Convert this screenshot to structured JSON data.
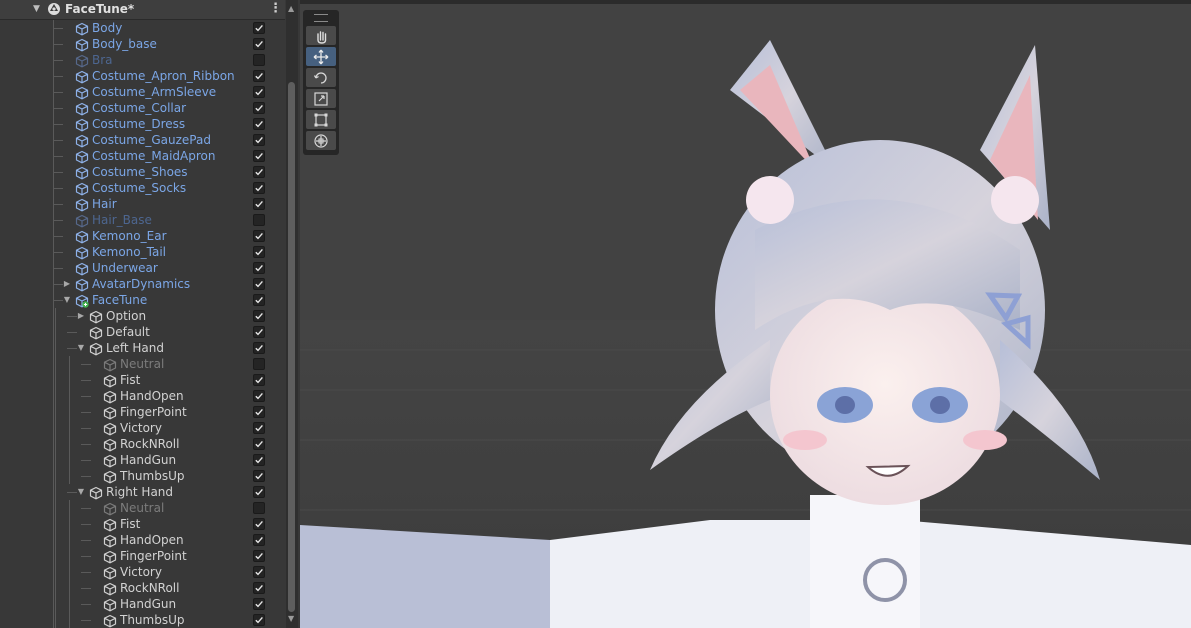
{
  "hierarchy": {
    "title": "FaceTune*",
    "items": [
      {
        "label": "Body",
        "depth": 1,
        "type": "prefab",
        "active": true,
        "checked": true,
        "fold": "none",
        "selected": false
      },
      {
        "label": "Body_base",
        "depth": 1,
        "type": "prefab",
        "active": true,
        "checked": true,
        "fold": "none",
        "selected": false
      },
      {
        "label": "Bra",
        "depth": 1,
        "type": "prefab",
        "active": false,
        "checked": false,
        "fold": "none",
        "selected": false
      },
      {
        "label": "Costume_Apron_Ribbon",
        "depth": 1,
        "type": "prefab",
        "active": true,
        "checked": true,
        "fold": "none",
        "selected": false
      },
      {
        "label": "Costume_ArmSleeve",
        "depth": 1,
        "type": "prefab",
        "active": true,
        "checked": true,
        "fold": "none",
        "selected": false
      },
      {
        "label": "Costume_Collar",
        "depth": 1,
        "type": "prefab",
        "active": true,
        "checked": true,
        "fold": "none",
        "selected": false
      },
      {
        "label": "Costume_Dress",
        "depth": 1,
        "type": "prefab",
        "active": true,
        "checked": true,
        "fold": "none",
        "selected": false
      },
      {
        "label": "Costume_GauzePad",
        "depth": 1,
        "type": "prefab",
        "active": true,
        "checked": true,
        "fold": "none",
        "selected": false
      },
      {
        "label": "Costume_MaidApron",
        "depth": 1,
        "type": "prefab",
        "active": true,
        "checked": true,
        "fold": "none",
        "selected": false
      },
      {
        "label": "Costume_Shoes",
        "depth": 1,
        "type": "prefab",
        "active": true,
        "checked": true,
        "fold": "none",
        "selected": false
      },
      {
        "label": "Costume_Socks",
        "depth": 1,
        "type": "prefab",
        "active": true,
        "checked": true,
        "fold": "none",
        "selected": false
      },
      {
        "label": "Hair",
        "depth": 1,
        "type": "prefab",
        "active": true,
        "checked": true,
        "fold": "none",
        "selected": false
      },
      {
        "label": "Hair_Base",
        "depth": 1,
        "type": "prefab",
        "active": false,
        "checked": false,
        "fold": "none",
        "selected": false
      },
      {
        "label": "Kemono_Ear",
        "depth": 1,
        "type": "prefab",
        "active": true,
        "checked": true,
        "fold": "none",
        "selected": false
      },
      {
        "label": "Kemono_Tail",
        "depth": 1,
        "type": "prefab",
        "active": true,
        "checked": true,
        "fold": "none",
        "selected": false
      },
      {
        "label": "Underwear",
        "depth": 1,
        "type": "prefab",
        "active": true,
        "checked": true,
        "fold": "none",
        "selected": false
      },
      {
        "label": "AvatarDynamics",
        "depth": 1,
        "type": "prefab-variant",
        "active": true,
        "checked": true,
        "fold": "collapsed",
        "selected": false
      },
      {
        "label": "FaceTune",
        "depth": 1,
        "type": "prefab-added",
        "active": true,
        "checked": true,
        "fold": "expanded",
        "selected": false
      },
      {
        "label": "Option",
        "depth": 2,
        "type": "normal",
        "active": true,
        "checked": true,
        "fold": "collapsed",
        "selected": false
      },
      {
        "label": "Default",
        "depth": 2,
        "type": "normal",
        "active": true,
        "checked": true,
        "fold": "none",
        "selected": false
      },
      {
        "label": "Left Hand",
        "depth": 2,
        "type": "normal",
        "active": true,
        "checked": true,
        "fold": "expanded",
        "selected": false
      },
      {
        "label": "Neutral",
        "depth": 3,
        "type": "normal",
        "active": false,
        "checked": false,
        "fold": "none",
        "selected": false
      },
      {
        "label": "Fist",
        "depth": 3,
        "type": "normal",
        "active": true,
        "checked": true,
        "fold": "none",
        "selected": false
      },
      {
        "label": "HandOpen",
        "depth": 3,
        "type": "normal",
        "active": true,
        "checked": true,
        "fold": "none",
        "selected": false
      },
      {
        "label": "FingerPoint",
        "depth": 3,
        "type": "normal",
        "active": true,
        "checked": true,
        "fold": "none",
        "selected": false
      },
      {
        "label": "Victory",
        "depth": 3,
        "type": "normal",
        "active": true,
        "checked": true,
        "fold": "none",
        "selected": false
      },
      {
        "label": "RockNRoll",
        "depth": 3,
        "type": "normal",
        "active": true,
        "checked": true,
        "fold": "none",
        "selected": false
      },
      {
        "label": "HandGun",
        "depth": 3,
        "type": "normal",
        "active": true,
        "checked": true,
        "fold": "none",
        "selected": false
      },
      {
        "label": "ThumbsUp",
        "depth": 3,
        "type": "normal",
        "active": true,
        "checked": true,
        "fold": "none",
        "selected": false
      },
      {
        "label": "Right Hand",
        "depth": 2,
        "type": "normal",
        "active": true,
        "checked": true,
        "fold": "expanded",
        "selected": false
      },
      {
        "label": "Neutral",
        "depth": 3,
        "type": "normal",
        "active": false,
        "checked": false,
        "fold": "none",
        "selected": false
      },
      {
        "label": "Fist",
        "depth": 3,
        "type": "normal",
        "active": true,
        "checked": true,
        "fold": "none",
        "selected": false
      },
      {
        "label": "HandOpen",
        "depth": 3,
        "type": "normal",
        "active": true,
        "checked": true,
        "fold": "none",
        "selected": false
      },
      {
        "label": "FingerPoint",
        "depth": 3,
        "type": "normal",
        "active": true,
        "checked": true,
        "fold": "none",
        "selected": false
      },
      {
        "label": "Victory",
        "depth": 3,
        "type": "normal",
        "active": true,
        "checked": true,
        "fold": "none",
        "selected": false
      },
      {
        "label": "RockNRoll",
        "depth": 3,
        "type": "normal",
        "active": true,
        "checked": true,
        "fold": "none",
        "selected": false
      },
      {
        "label": "HandGun",
        "depth": 3,
        "type": "normal",
        "active": true,
        "checked": true,
        "fold": "none",
        "selected": false
      },
      {
        "label": "ThumbsUp",
        "depth": 3,
        "type": "normal",
        "active": true,
        "checked": true,
        "fold": "none",
        "selected": false
      }
    ]
  },
  "scene_tools": [
    {
      "name": "hand-tool",
      "icon": "hand-icon",
      "active": false
    },
    {
      "name": "move-tool",
      "icon": "move-arrows-icon",
      "active": true
    },
    {
      "name": "rotate-tool",
      "icon": "rotate-icon",
      "active": false
    },
    {
      "name": "scale-tool",
      "icon": "scale-icon",
      "active": false
    },
    {
      "name": "rect-tool",
      "icon": "rect-transform-icon",
      "active": false
    },
    {
      "name": "transform-tool",
      "icon": "transform-icon",
      "active": false
    }
  ],
  "colors": {
    "panel_bg": "#383838",
    "selection": "#2c5d87",
    "prefab_text": "#7ba6e6",
    "scene_bg": "#424242"
  }
}
